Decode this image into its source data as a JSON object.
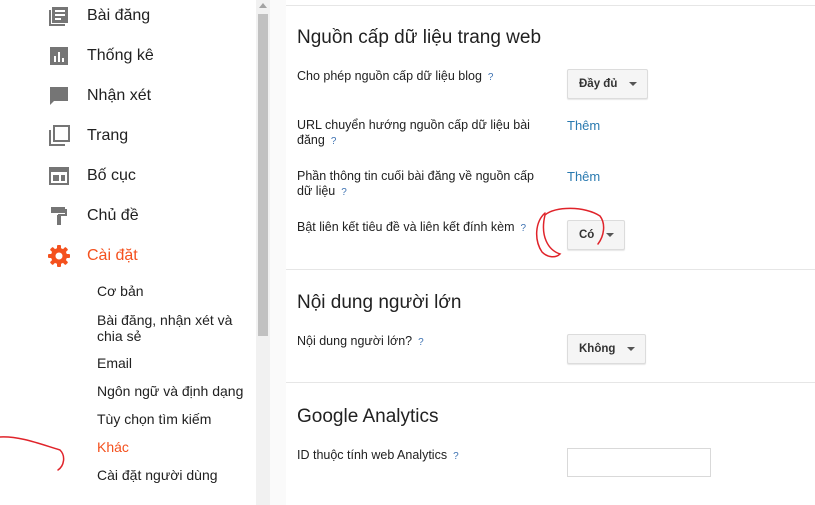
{
  "sidebar": {
    "items": [
      {
        "label": "Bài đăng",
        "icon": "posts-icon"
      },
      {
        "label": "Thống kê",
        "icon": "stats-icon"
      },
      {
        "label": "Nhận xét",
        "icon": "comments-icon"
      },
      {
        "label": "Trang",
        "icon": "pages-icon"
      },
      {
        "label": "Bố cục",
        "icon": "layout-icon"
      },
      {
        "label": "Chủ đề",
        "icon": "theme-icon"
      },
      {
        "label": "Cài đặt",
        "icon": "gear-icon",
        "active": true
      }
    ],
    "subitems": [
      {
        "label": "Cơ bản"
      },
      {
        "label": "Bài đăng, nhận xét và chia sẻ"
      },
      {
        "label": "Email"
      },
      {
        "label": "Ngôn ngữ và định dạng"
      },
      {
        "label": "Tùy chọn tìm kiếm"
      },
      {
        "label": "Khác",
        "active": true
      },
      {
        "label": "Cài đặt người dùng"
      }
    ]
  },
  "main": {
    "feed": {
      "title": "Nguồn cấp dữ liệu trang web",
      "rows": [
        {
          "label": "Cho phép nguồn cấp dữ liệu blog",
          "help": "?",
          "value": "Đầy đủ"
        },
        {
          "label": "URL chuyển hướng nguồn cấp dữ liệu bài đăng",
          "help": "?",
          "link": "Thêm"
        },
        {
          "label": "Phần thông tin cuối bài đăng về nguồn cấp dữ liệu",
          "help": "?",
          "link": "Thêm"
        },
        {
          "label": "Bật liên kết tiêu đề và liên kết đính kèm",
          "help": "?",
          "value": "Có"
        }
      ]
    },
    "adult": {
      "title": "Nội dung người lớn",
      "rows": [
        {
          "label": "Nội dung người lớn?",
          "help": "?",
          "value": "Không"
        }
      ]
    },
    "analytics": {
      "title": "Google Analytics",
      "rows": [
        {
          "label": "ID thuộc tính web Analytics",
          "help": "?",
          "input_value": ""
        }
      ]
    }
  },
  "colors": {
    "accent": "#f4511e",
    "link": "#2a7ab0",
    "annotation": "#e0232a",
    "icon": "#757575"
  }
}
